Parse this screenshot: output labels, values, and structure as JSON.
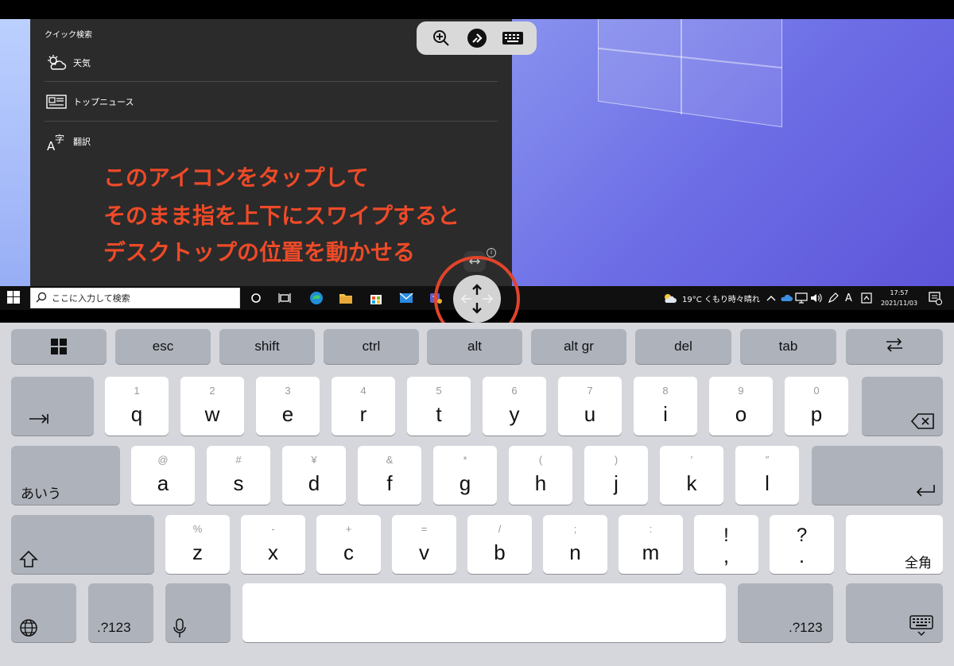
{
  "desktop": {
    "search_panel": {
      "title": "クイック検索",
      "items": [
        {
          "label": "天気",
          "icon": "weather-icon"
        },
        {
          "label": "トップニュース",
          "icon": "news-icon"
        },
        {
          "label": "翻訳",
          "icon": "translate-icon"
        }
      ]
    },
    "annotation": [
      "このアイコンをタップして",
      "そのまま指を上下にスワイプすると",
      "デスクトップの位置を動かせる"
    ],
    "annotation_color": "#ee4a28"
  },
  "remote_toolbar": {
    "buttons": [
      "zoom-in-icon",
      "remote-connection-icon",
      "keyboard-icon"
    ]
  },
  "taskbar": {
    "search_placeholder": "ここに入力して検索",
    "weather": "19°C くもり時々晴れ",
    "ime": "A",
    "time": "17:57",
    "date": "2021/11/03",
    "notification_count": "1"
  },
  "keyboard": {
    "function_row": [
      "esc",
      "shift",
      "ctrl",
      "alt",
      "alt gr",
      "del",
      "tab"
    ],
    "row1": [
      {
        "sub": "1",
        "main": "q"
      },
      {
        "sub": "2",
        "main": "w"
      },
      {
        "sub": "3",
        "main": "e"
      },
      {
        "sub": "4",
        "main": "r"
      },
      {
        "sub": "5",
        "main": "t"
      },
      {
        "sub": "6",
        "main": "y"
      },
      {
        "sub": "7",
        "main": "u"
      },
      {
        "sub": "8",
        "main": "i"
      },
      {
        "sub": "9",
        "main": "o"
      },
      {
        "sub": "0",
        "main": "p"
      }
    ],
    "row2": [
      {
        "sub": "@",
        "main": "a"
      },
      {
        "sub": "#",
        "main": "s"
      },
      {
        "sub": "¥",
        "main": "d"
      },
      {
        "sub": "&",
        "main": "f"
      },
      {
        "sub": "*",
        "main": "g"
      },
      {
        "sub": "(",
        "main": "h"
      },
      {
        "sub": ")",
        "main": "j"
      },
      {
        "sub": "′",
        "main": "k"
      },
      {
        "sub": "″",
        "main": "l"
      }
    ],
    "row3": [
      {
        "sub": "%",
        "main": "z"
      },
      {
        "sub": "-",
        "main": "x"
      },
      {
        "sub": "+",
        "main": "c"
      },
      {
        "sub": "=",
        "main": "v"
      },
      {
        "sub": "/",
        "main": "b"
      },
      {
        "sub": ";",
        "main": "n"
      },
      {
        "sub": ":",
        "main": "m"
      },
      {
        "sub": "!",
        "main": ","
      },
      {
        "sub": "?",
        "main": "."
      }
    ],
    "kana_label": "あいう",
    "zenkaku_label": "全角",
    "numbers_label": ".?123"
  }
}
